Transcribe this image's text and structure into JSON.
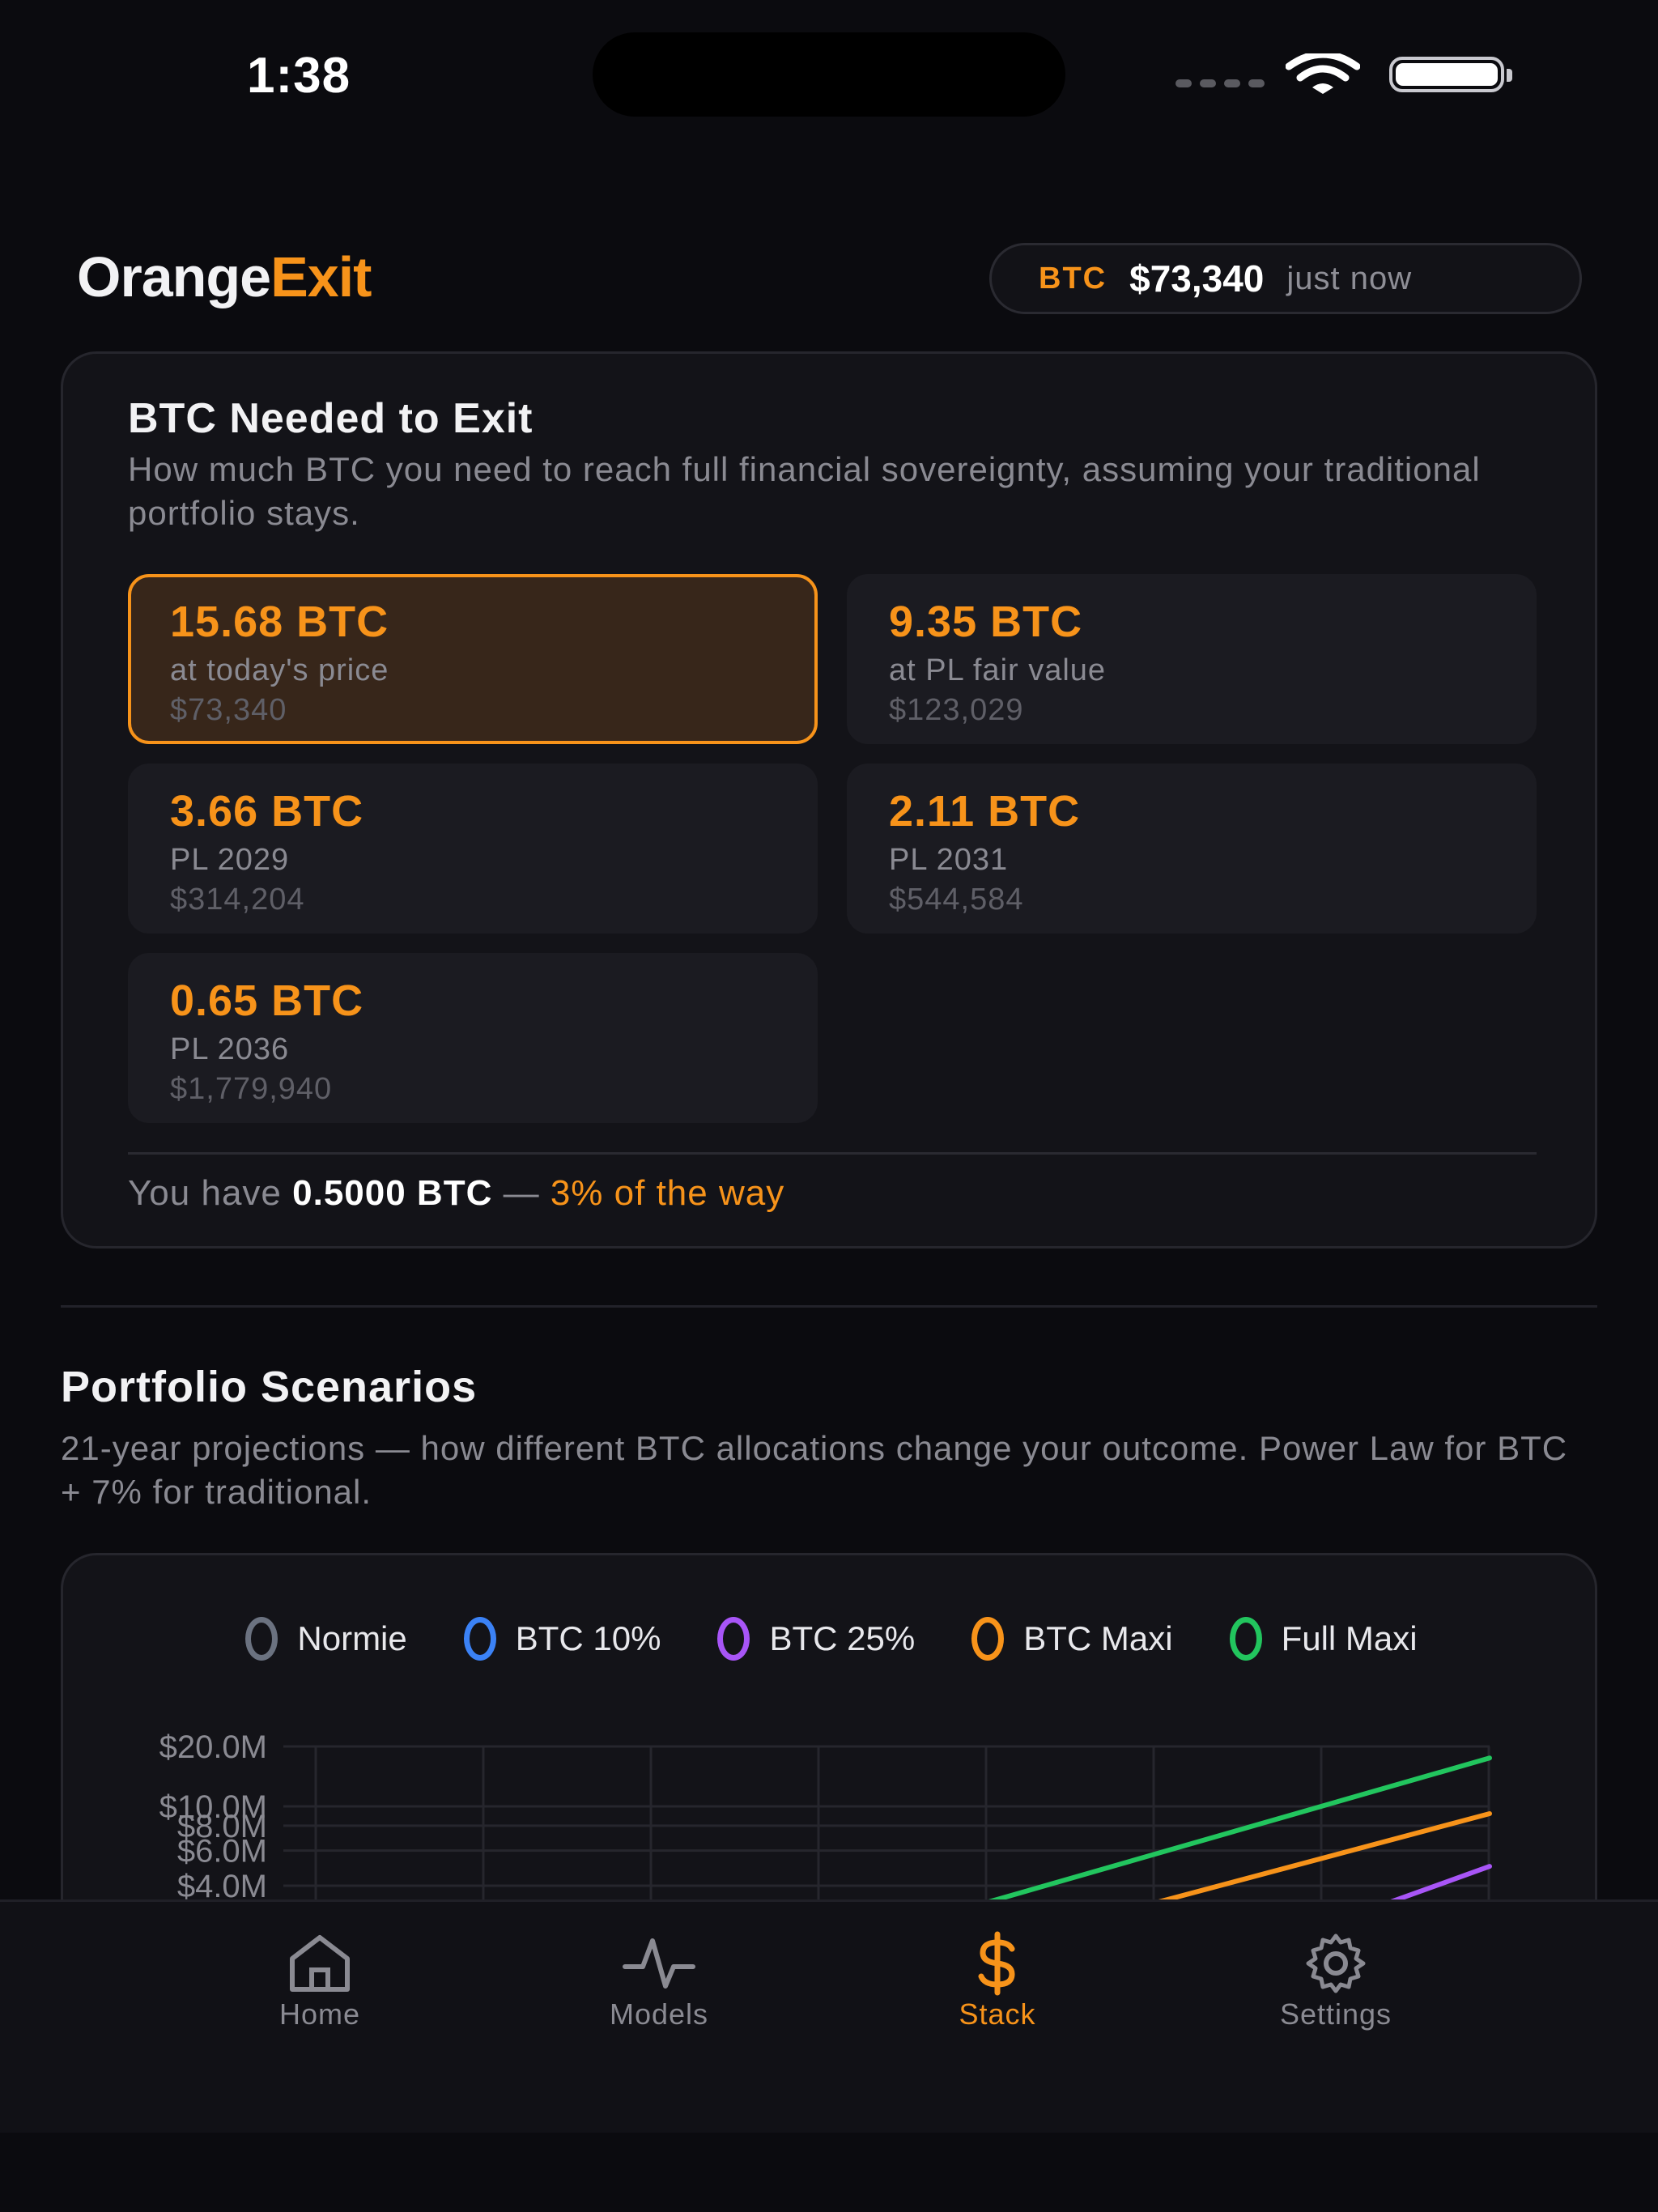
{
  "status": {
    "time": "1:38"
  },
  "header": {
    "brand_part1": "Orange",
    "brand_part2": "Exit",
    "ticker": "BTC",
    "price": "$73,340",
    "updated": "just now"
  },
  "exit_card": {
    "title": "BTC Needed to Exit",
    "subtitle": "How much BTC you need to reach full financial sovereignty, assuming your traditional portfolio stays.",
    "tiles": [
      {
        "btc": "15.68 BTC",
        "label": "at today's price",
        "usd": "$73,340"
      },
      {
        "btc": "9.35 BTC",
        "label": "at PL fair value",
        "usd": "$123,029"
      },
      {
        "btc": "3.66 BTC",
        "label": "PL 2029",
        "usd": "$314,204"
      },
      {
        "btc": "2.11 BTC",
        "label": "PL 2031",
        "usd": "$544,584"
      },
      {
        "btc": "0.65 BTC",
        "label": "PL 2036",
        "usd": "$1,779,940"
      }
    ],
    "have_prefix": "You have",
    "have_amount": "0.5000 BTC",
    "have_sep": "—",
    "have_progress": "3% of the way"
  },
  "scenarios": {
    "title": "Portfolio Scenarios",
    "subtitle": "21-year projections — how different BTC allocations change your outcome. Power Law for BTC + 7% for traditional."
  },
  "chart_data": {
    "type": "line",
    "y_scale": "log",
    "y_ticks": [
      "$20.0M",
      "$10.0M",
      "$8.0M",
      "$6.0M",
      "$4.0M"
    ],
    "y_tick_values": [
      20000000,
      10000000,
      8000000,
      6000000,
      4000000
    ],
    "grid": true,
    "legend_position": "top-center",
    "x_range": [
      0,
      21
    ],
    "series": [
      {
        "name": "Normie",
        "color": "#6b7280",
        "points": []
      },
      {
        "name": "BTC 10%",
        "color": "#3b82f6",
        "points": []
      },
      {
        "name": "BTC 25%",
        "color": "#a855f7",
        "points": [
          [
            18.8,
            3000000
          ],
          [
            21,
            5000000
          ]
        ]
      },
      {
        "name": "BTC Maxi",
        "color": "#f7931a",
        "points": [
          [
            14.5,
            3000000
          ],
          [
            21,
            9200000
          ]
        ]
      },
      {
        "name": "Full Maxi",
        "color": "#22c55e",
        "points": [
          [
            11.5,
            3000000
          ],
          [
            21,
            17500000
          ]
        ]
      }
    ]
  },
  "tabs": [
    {
      "label": "Home",
      "icon": "house-icon",
      "active": false
    },
    {
      "label": "Models",
      "icon": "activity-icon",
      "active": false
    },
    {
      "label": "Stack",
      "icon": "dollar-icon",
      "active": true
    },
    {
      "label": "Settings",
      "icon": "gear-icon",
      "active": false
    }
  ],
  "colors": {
    "accent": "#f7931a",
    "background": "#0b0b0f",
    "card": "#131318",
    "muted_text": "#8a8a92"
  }
}
